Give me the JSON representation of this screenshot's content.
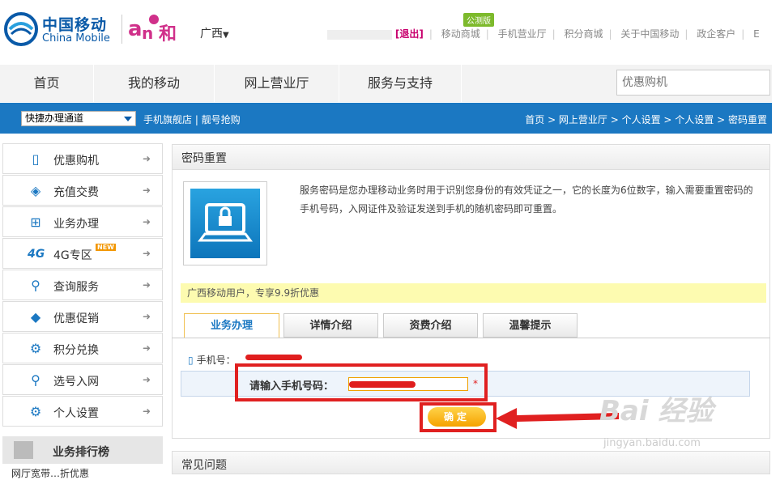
{
  "header": {
    "logo_zh": "中国移动",
    "logo_en": "China Mobile",
    "logo_he": "和",
    "region": "广西",
    "logout": "[退出]",
    "links": [
      "移动商城",
      "手机营业厅",
      "积分商城",
      "关于中国移动",
      "政企客户",
      "E"
    ],
    "mall_badge": "公测版"
  },
  "nav": {
    "items": [
      "首页",
      "我的移动",
      "网上营业厅",
      "服务与支持"
    ],
    "search_placeholder": "优惠购机"
  },
  "bar": {
    "quick_select": "快捷办理通道",
    "links": "手机旗舰店 | 靓号抢购",
    "breadcrumb": "首页 > 网上营业厅 > 个人设置 > 个人设置 > 密码重置"
  },
  "sidebar": {
    "items": [
      {
        "label": "优惠购机",
        "icon": "phone-icon"
      },
      {
        "label": "充值交费",
        "icon": "card-icon"
      },
      {
        "label": "业务办理",
        "icon": "org-icon"
      },
      {
        "label": "4G专区",
        "icon": "4g-icon",
        "badge": "NEW"
      },
      {
        "label": "查询服务",
        "icon": "search-person-icon"
      },
      {
        "label": "优惠促销",
        "icon": "tag-icon"
      },
      {
        "label": "积分兑换",
        "icon": "gear-icon"
      },
      {
        "label": "选号入网",
        "icon": "search-person-icon"
      },
      {
        "label": "个人设置",
        "icon": "gear-icon"
      }
    ],
    "ranking_title": "业务排行榜",
    "ranking_sub": "网厅宽带…折优惠"
  },
  "main": {
    "title": "密码重置",
    "description": "服务密码是您办理移动业务时用于识别您身份的有效凭证之一，它的长度为6位数字，输入需要重置密码的手机号码，入网证件及验证发送到手机的随机密码即可重置。",
    "promo": "广西移动用户，专享9.9折优惠",
    "tabs": [
      "业务办理",
      "详情介绍",
      "资费介绍",
      "温馨提示"
    ],
    "phone_label": "手机号：",
    "form_label": "请输入手机号码：",
    "required_mark": "*",
    "confirm": "确定",
    "faq_title": "常见问题"
  },
  "watermark": {
    "main": "Bai 经验",
    "sub": "jingyan.baidu.com"
  }
}
